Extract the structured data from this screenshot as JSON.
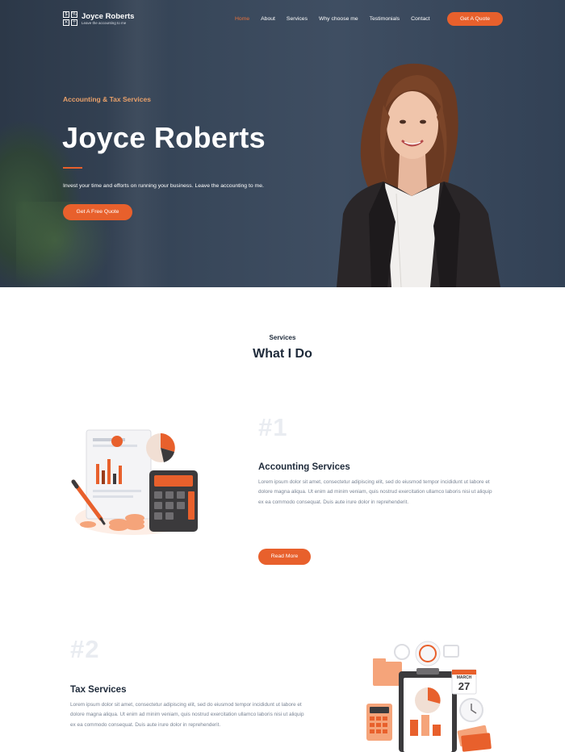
{
  "brand": {
    "name": "Joyce Roberts",
    "tagline": "Leave the accounting to me",
    "logo_cells": [
      "$",
      "%",
      "×",
      "÷"
    ]
  },
  "nav": {
    "items": [
      "Home",
      "About",
      "Services",
      "Why choose me",
      "Testimonials",
      "Contact"
    ],
    "active": "Home",
    "cta_label": "Get A Quote"
  },
  "hero": {
    "eyebrow": "Accounting & Tax Services",
    "title": "Joyce Roberts",
    "text": "Invest your time and efforts on running your business. Leave the accounting to me.",
    "button_label": "Get A Free Quote"
  },
  "services": {
    "eyebrow": "Services",
    "title": "What I Do",
    "items": [
      {
        "number": "#1",
        "title": "Accounting Services",
        "text": "Lorem ipsum dolor sit amet, consectetur adipiscing elit, sed do eiusmod tempor incididunt ut labore et dolore magna aliqua. Ut enim ad minim veniam, quis nostrud exercitation ullamco laboris nisi ut aliquip ex ea commodo consequat. Duis aute irure dolor in reprehenderit.",
        "button_label": "Read More"
      },
      {
        "number": "#2",
        "title": "Tax Services",
        "text": "Lorem ipsum dolor sit amet, consectetur adipiscing elit, sed do eiusmod tempor incididunt ut labore et dolore magna aliqua. Ut enim ad minim veniam, quis nostrud exercitation ullamco laboris nisi ut aliquip ex ea commodo consequat. Duis aute irure dolor in reprehenderit."
      }
    ]
  },
  "calendar": {
    "month": "MARCH",
    "day": "27"
  },
  "colors": {
    "accent": "#e8602c",
    "hero_bg": "#38475a",
    "heading": "#1e2a3a",
    "body_text": "#7a8494",
    "number_watermark": "#e9ecf1"
  }
}
